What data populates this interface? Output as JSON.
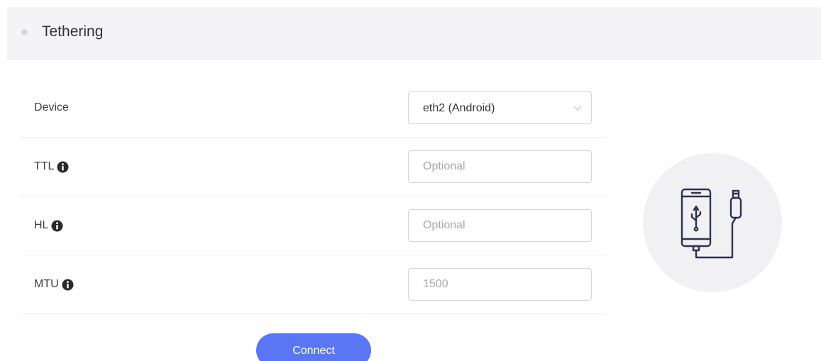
{
  "header": {
    "title": "Tethering"
  },
  "form": {
    "device": {
      "label": "Device",
      "value": "eth2 (Android)"
    },
    "ttl": {
      "label": "TTL",
      "placeholder": "Optional"
    },
    "hl": {
      "label": "HL",
      "placeholder": "Optional"
    },
    "mtu": {
      "label": "MTU",
      "placeholder": "1500"
    }
  },
  "actions": {
    "connect_label": "Connect"
  },
  "icons": {
    "header": "status-dot-icon",
    "info": "info-circle-icon",
    "select": "chevron-down-icon",
    "illustration": "phone-usb-icon"
  },
  "colors": {
    "accent": "#5b76f4",
    "header_bg": "#f4f4f6",
    "illustration_bg": "#f1f1f4",
    "icon_stroke": "#2f3150"
  }
}
